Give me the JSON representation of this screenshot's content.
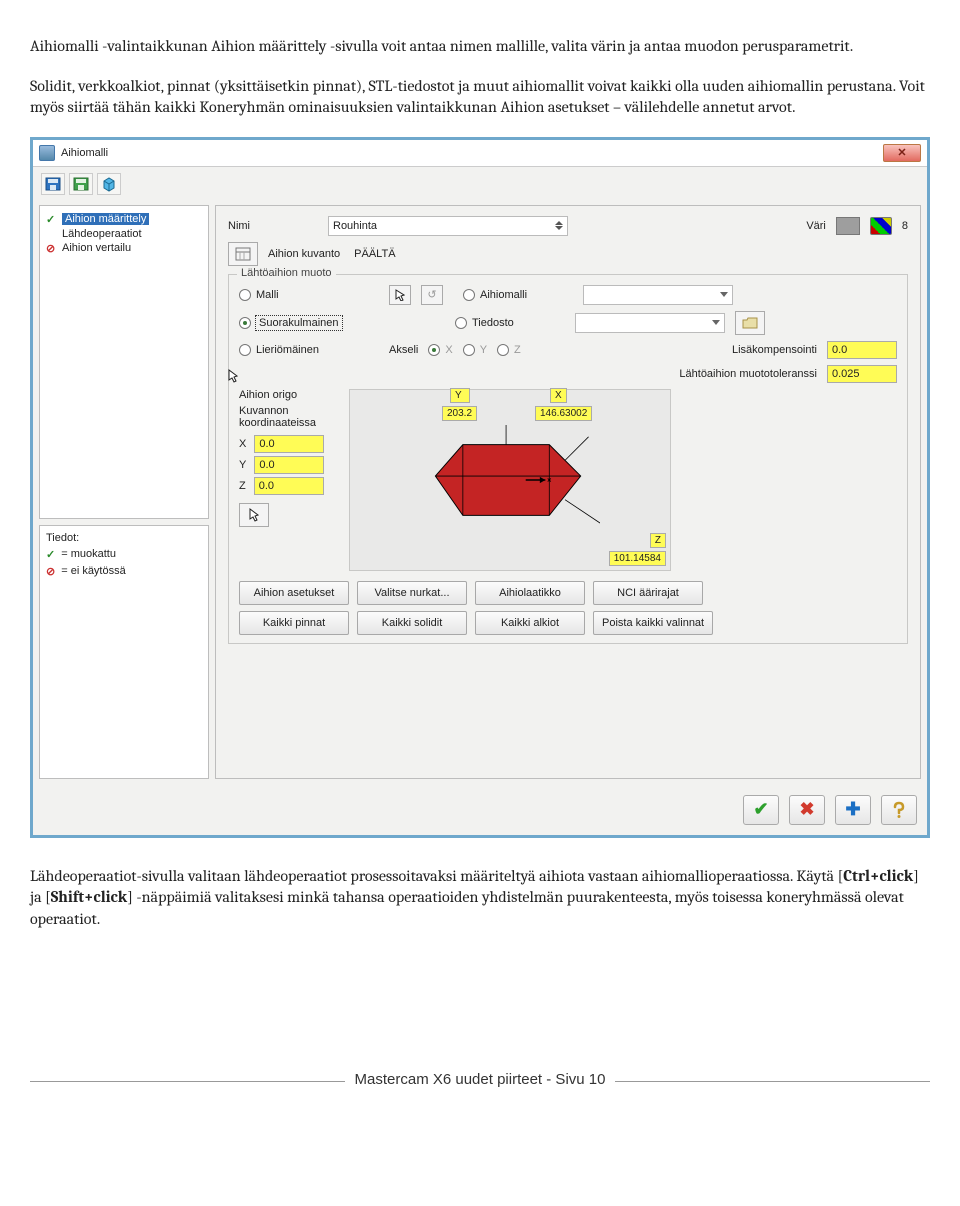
{
  "paragraph1": "Aihiomalli -valintaikkunan Aihion määrittely -sivulla voit antaa nimen mallille, valita värin ja antaa muodon perusparametrit.",
  "paragraph2": "Solidit, verkkoalkiot, pinnat (yksittäisetkin pinnat), STL-tiedostot ja muut aihiomallit voivat kaikki olla uuden aihiomallin perustana. Voit myös siirtää tähän kaikki Koneryhmän ominaisuuksien valintaikkunan Aihion asetukset – välilehdelle annetut arvot.",
  "paragraph3_pre": "Lähdeoperaatiot-sivulla valitaan lähdeoperaatiot prosessoitavaksi määriteltyä aihiota vastaan aihiomallioperaatiossa. Käytä [",
  "paragraph3_b1": "Ctrl+click",
  "paragraph3_mid": "] ja [",
  "paragraph3_b2": "Shift+click",
  "paragraph3_post": "] -näppäimiä valitaksesi minkä tahansa operaatioiden yhdistelmän puurakenteesta, myös toisessa koneryhmässä olevat operaatiot.",
  "footer": "Mastercam X6 uudet piirteet - Sivu 10",
  "window": {
    "title": "Aihiomalli",
    "tree": {
      "item1": "Aihion määrittely",
      "item2": "Lähdeoperaatiot",
      "item3": "Aihion vertailu"
    },
    "info": {
      "heading": "Tiedot:",
      "legend1": "= muokattu",
      "legend2": "= ei käytössä"
    },
    "panel": {
      "name_label": "Nimi",
      "name_value": "Rouhinta",
      "color_label": "Väri",
      "color_value": "8",
      "kuvanto_label": "Aihion kuvanto",
      "kuvanto_value": "PÄÄLTÄ",
      "group1_title": "Lähtöaihion muoto",
      "opt_malli": "Malli",
      "opt_aihiomalli": "Aihiomalli",
      "opt_suorak": "Suorakulmainen",
      "opt_tiedosto": "Tiedosto",
      "opt_lierio": "Lieriömäinen",
      "akseli": "Akseli",
      "axX": "X",
      "axY": "Y",
      "axZ": "Z",
      "lisakomp": "Lisäkompensointi",
      "lisakomp_val": "0.0",
      "muototol": "Lähtöaihion muototoleranssi",
      "muototol_val": "0.025",
      "origo_title": "Aihion origo",
      "kuvannon": "Kuvannon koordinaateissa",
      "oX": "X",
      "oY": "Y",
      "oZ": "Z",
      "oXv": "0.0",
      "oYv": "0.0",
      "oZv": "0.0",
      "dY_label": "Y",
      "dY_val": "203.2",
      "dX_label": "X",
      "dX_val": "146.63002",
      "dZ_label": "Z",
      "dZ_val": "101.14584",
      "btn1": "Aihion asetukset",
      "btn2": "Valitse nurkat...",
      "btn3": "Aihiolaatikko",
      "btn4": "NCI äärirajat",
      "btn5": "Kaikki pinnat",
      "btn6": "Kaikki solidit",
      "btn7": "Kaikki alkiot",
      "btn8": "Poista kaikki valinnat"
    }
  }
}
